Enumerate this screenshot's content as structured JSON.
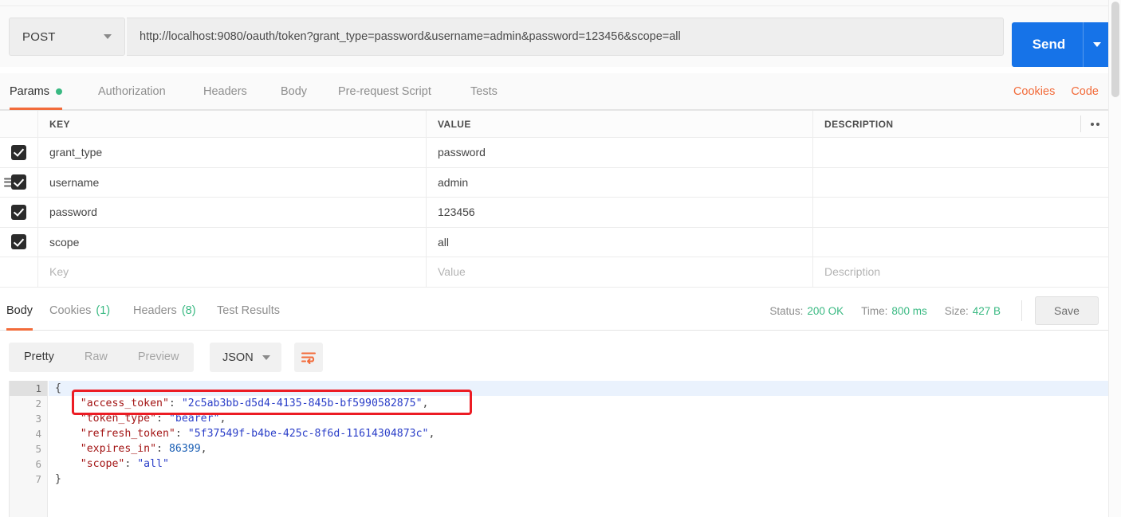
{
  "request": {
    "method": "POST",
    "url": "http://localhost:9080/oauth/token?grant_type=password&username=admin&password=123456&scope=all",
    "send_label": "Send"
  },
  "request_tabs": [
    {
      "label": "Params",
      "active": true,
      "has_dot": true
    },
    {
      "label": "Authorization",
      "active": false,
      "has_dot": false
    },
    {
      "label": "Headers",
      "active": false,
      "has_dot": false
    },
    {
      "label": "Body",
      "active": false,
      "has_dot": false
    },
    {
      "label": "Pre-request Script",
      "active": false,
      "has_dot": false
    },
    {
      "label": "Tests",
      "active": false,
      "has_dot": false
    }
  ],
  "request_tab_links": [
    {
      "label": "Cookies"
    },
    {
      "label": "Code"
    }
  ],
  "params_table": {
    "headers": {
      "key": "KEY",
      "value": "VALUE",
      "description": "DESCRIPTION"
    },
    "rows": [
      {
        "checked": true,
        "key": "grant_type",
        "value": "password",
        "description": ""
      },
      {
        "checked": true,
        "key": "username",
        "value": "admin",
        "description": ""
      },
      {
        "checked": true,
        "key": "password",
        "value": "123456",
        "description": ""
      },
      {
        "checked": true,
        "key": "scope",
        "value": "all",
        "description": ""
      }
    ],
    "empty_row": {
      "key_placeholder": "Key",
      "value_placeholder": "Value",
      "description_placeholder": "Description"
    }
  },
  "response_tabs": [
    {
      "label": "Body",
      "count": "",
      "active": true
    },
    {
      "label": "Cookies",
      "count": "(1)",
      "active": false
    },
    {
      "label": "Headers",
      "count": "(8)",
      "active": false
    },
    {
      "label": "Test Results",
      "count": "",
      "active": false
    }
  ],
  "response_meta": {
    "status_label": "Status:",
    "status_value": "200 OK",
    "time_label": "Time:",
    "time_value": "800 ms",
    "size_label": "Size:",
    "size_value": "427 B",
    "save_label": "Save"
  },
  "view_toolbar": {
    "modes": [
      {
        "label": "Pretty",
        "active": true
      },
      {
        "label": "Raw",
        "active": false
      },
      {
        "label": "Preview",
        "active": false
      }
    ],
    "format": "JSON",
    "wrap_icon": "word-wrap-icon"
  },
  "response_body": {
    "line_numbers": [
      "1",
      "2",
      "3",
      "4",
      "5",
      "6",
      "7"
    ],
    "lines": [
      [
        {
          "t": "{",
          "c": "p"
        }
      ],
      [
        {
          "t": "    ",
          "c": "p"
        },
        {
          "t": "\"access_token\"",
          "c": "k"
        },
        {
          "t": ": ",
          "c": "p"
        },
        {
          "t": "\"2c5ab3bb-d5d4-4135-845b-bf5990582875\"",
          "c": "s"
        },
        {
          "t": ",",
          "c": "p"
        }
      ],
      [
        {
          "t": "    ",
          "c": "p"
        },
        {
          "t": "\"token_type\"",
          "c": "k"
        },
        {
          "t": ": ",
          "c": "p"
        },
        {
          "t": "\"bearer\"",
          "c": "s"
        },
        {
          "t": ",",
          "c": "p"
        }
      ],
      [
        {
          "t": "    ",
          "c": "p"
        },
        {
          "t": "\"refresh_token\"",
          "c": "k"
        },
        {
          "t": ": ",
          "c": "p"
        },
        {
          "t": "\"5f37549f-b4be-425c-8f6d-11614304873c\"",
          "c": "s"
        },
        {
          "t": ",",
          "c": "p"
        }
      ],
      [
        {
          "t": "    ",
          "c": "p"
        },
        {
          "t": "\"expires_in\"",
          "c": "k"
        },
        {
          "t": ": ",
          "c": "p"
        },
        {
          "t": "86399",
          "c": "n"
        },
        {
          "t": ",",
          "c": "p"
        }
      ],
      [
        {
          "t": "    ",
          "c": "p"
        },
        {
          "t": "\"scope\"",
          "c": "k"
        },
        {
          "t": ": ",
          "c": "p"
        },
        {
          "t": "\"all\"",
          "c": "s"
        }
      ],
      [
        {
          "t": "}",
          "c": "p"
        }
      ]
    ],
    "json": {
      "access_token": "2c5ab3bb-d5d4-4135-845b-bf5990582875",
      "token_type": "bearer",
      "refresh_token": "5f37549f-b4be-425c-8f6d-11614304873c",
      "expires_in": 86399,
      "scope": "all"
    }
  },
  "annotation": {
    "highlight_line": 2,
    "color": "#ec1c24"
  },
  "colors": {
    "accent_orange": "#f26b3a",
    "send_blue": "#1673e8",
    "status_green": "#39b982",
    "annotation_red": "#ec1c24"
  }
}
